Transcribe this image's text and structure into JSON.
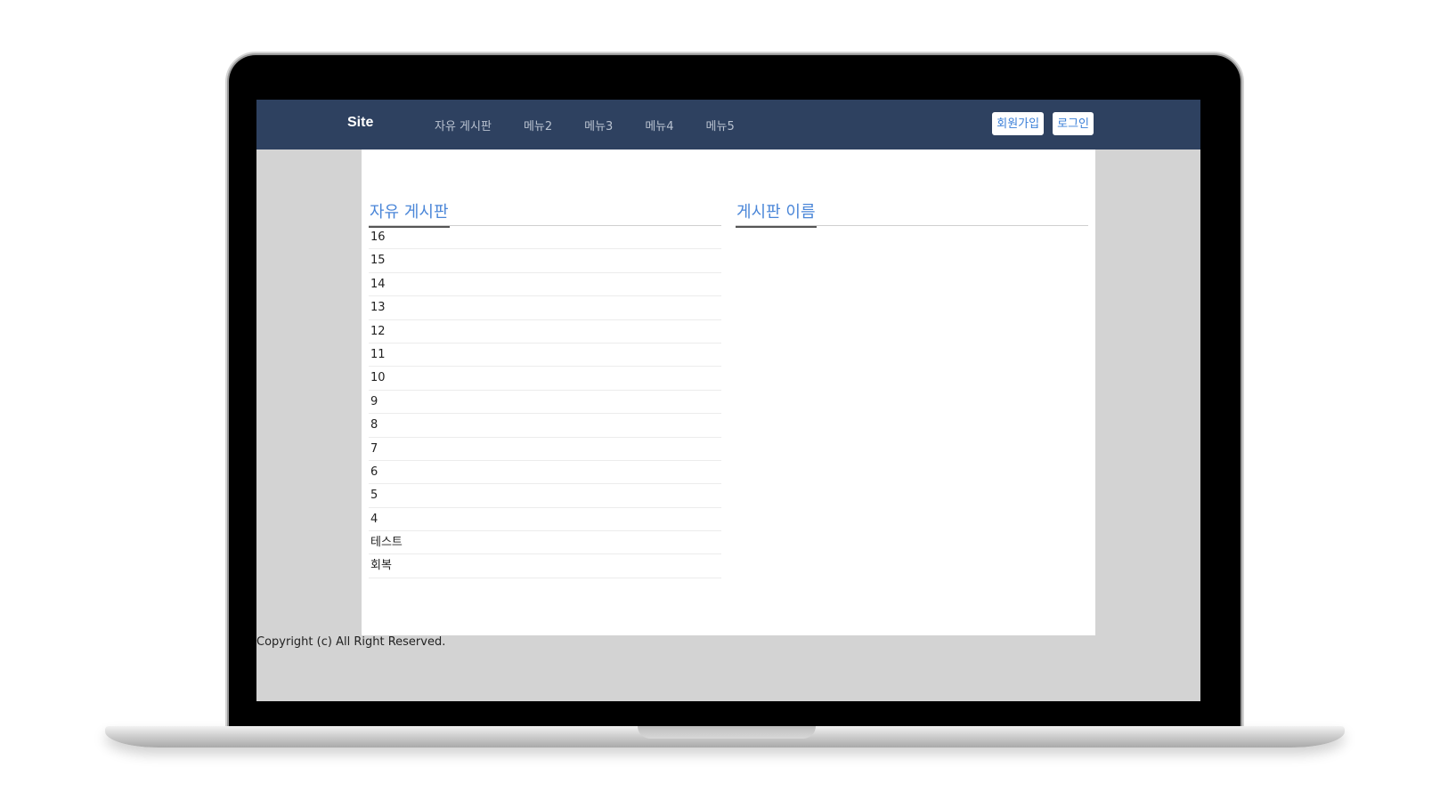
{
  "navbar": {
    "brand": "Site",
    "menu": [
      "자유 게시판",
      "메뉴2",
      "메뉴3",
      "메뉴4",
      "메뉴5"
    ],
    "signup_label": "회원가입",
    "login_label": "로그인"
  },
  "boards": {
    "left": {
      "title": "자유 게시판",
      "posts": [
        "16",
        "15",
        "14",
        "13",
        "12",
        "11",
        "10",
        "9",
        "8",
        "7",
        "6",
        "5",
        "4",
        "테스트",
        "회복"
      ]
    },
    "right": {
      "title": "게시판 이름",
      "posts": []
    }
  },
  "footer": {
    "text": "Copyright (c) All Right Reserved."
  },
  "colors": {
    "navbar_bg": "#2e4160",
    "accent": "#4a86d8",
    "page_bg": "#d3d3d3"
  }
}
